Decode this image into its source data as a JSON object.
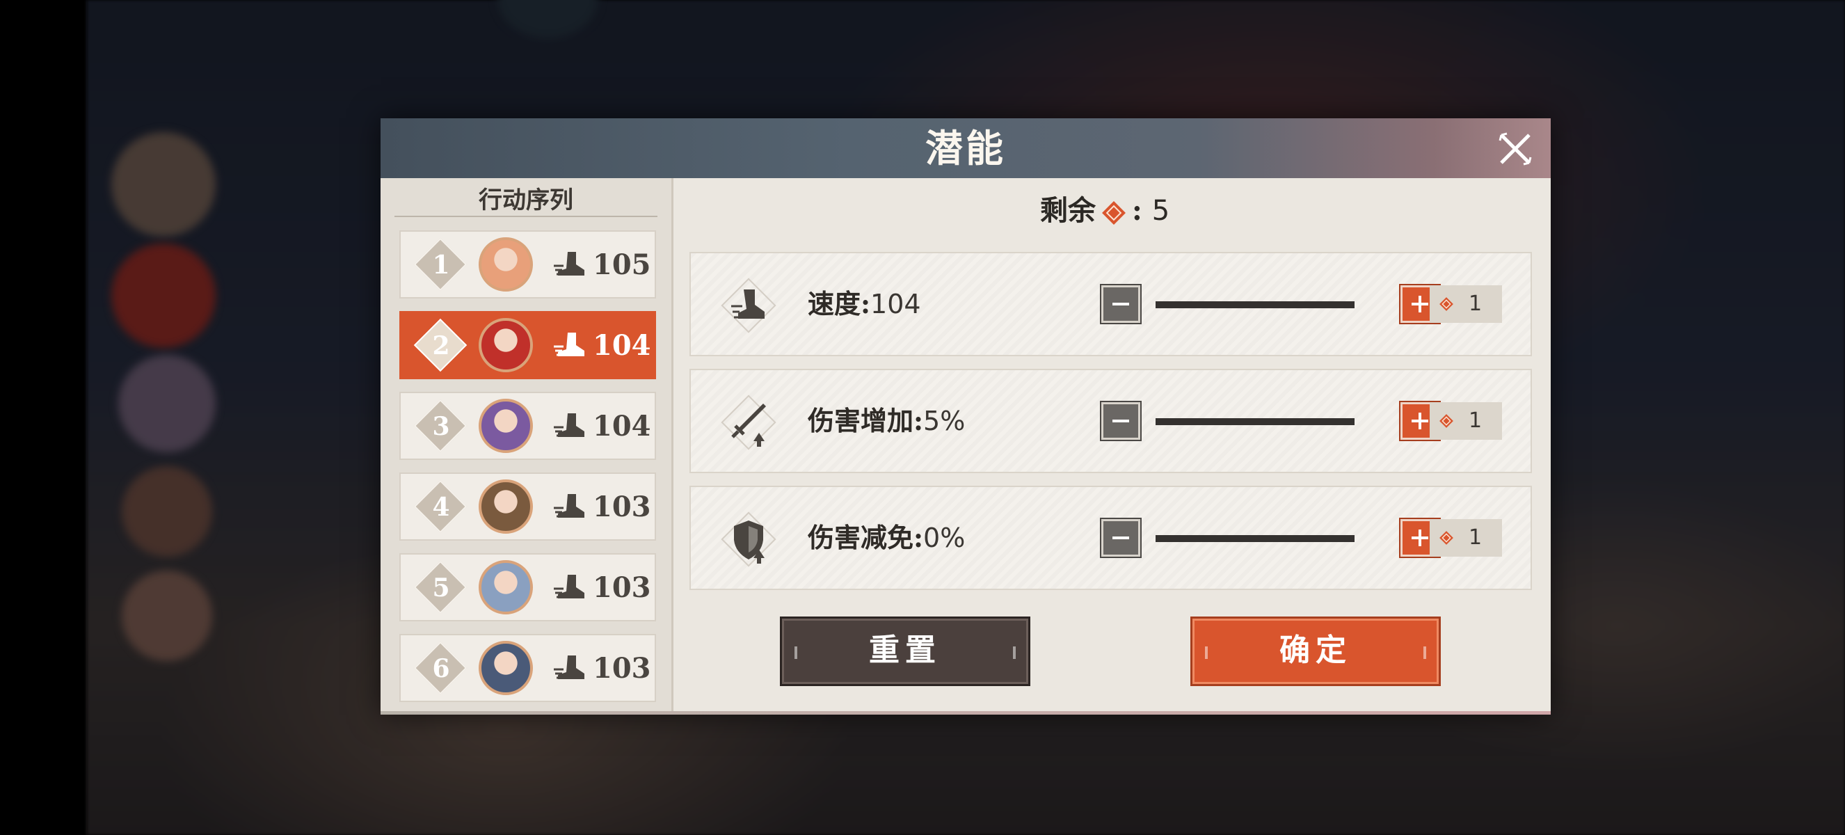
{
  "dialog": {
    "title": "潜能",
    "close_icon": "close-icon"
  },
  "left_panel": {
    "title": "行动序列",
    "rows": [
      {
        "rank": "1",
        "speed": "105",
        "active": false,
        "avatar_color": "#e8a07a"
      },
      {
        "rank": "2",
        "speed": "104",
        "active": true,
        "avatar_color": "#c0302a"
      },
      {
        "rank": "3",
        "speed": "104",
        "active": false,
        "avatar_color": "#7b5aa0"
      },
      {
        "rank": "4",
        "speed": "103",
        "active": false,
        "avatar_color": "#7a5a3e"
      },
      {
        "rank": "5",
        "speed": "103",
        "active": false,
        "avatar_color": "#8aa0c0"
      },
      {
        "rank": "6",
        "speed": "103",
        "active": false,
        "avatar_color": "#4a5a78"
      }
    ]
  },
  "remain": {
    "label": "剩余",
    "colon": ":",
    "value": "5"
  },
  "stats": [
    {
      "label": "速度:",
      "value": "104",
      "cost": "1",
      "icon": "speed-boot-icon"
    },
    {
      "label": "伤害增加:",
      "value": "5%",
      "cost": "1",
      "icon": "sword-up-icon"
    },
    {
      "label": "伤害减免:",
      "value": "0%",
      "cost": "1",
      "icon": "shield-up-icon"
    }
  ],
  "buttons": {
    "reset": "重置",
    "confirm": "确定"
  },
  "colors": {
    "accent": "#d9552d",
    "dark_button": "#4b403d",
    "panel": "#ebe7e0"
  }
}
